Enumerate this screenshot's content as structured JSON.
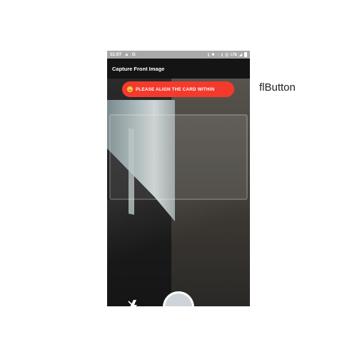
{
  "status_bar": {
    "time": "11:07",
    "left_icons": [
      "warning-icon",
      "sync-icon"
    ],
    "right_icons": [
      "volte-icon",
      "bluetooth-icon",
      "alarm-icon",
      "vibrate-icon",
      "nfc-icon",
      "lte-icon",
      "signal-icon",
      "battery-icon"
    ],
    "lte_text": "LTE"
  },
  "app_bar": {
    "title": "Capture Front Image"
  },
  "banner": {
    "text": "PLEASE ALIGN THE CARD WITHIN",
    "color": "#f43a2c",
    "icon": "smiley-icon"
  },
  "controls": {
    "flash_icon": "flash-off-icon",
    "shutter_icon": "shutter-button"
  },
  "side_label": {
    "text": "flButton"
  }
}
